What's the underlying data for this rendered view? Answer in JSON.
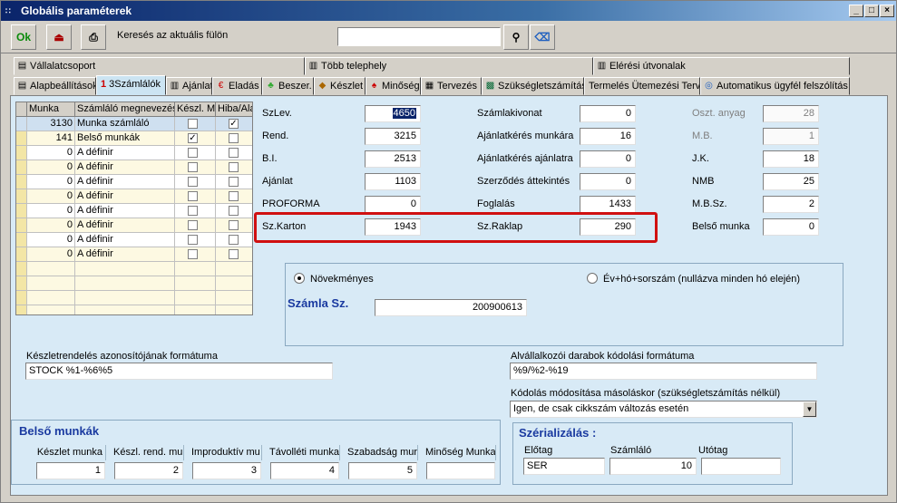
{
  "window": {
    "title": "Globális paraméterek"
  },
  "toolbar": {
    "ok_label": "Ok",
    "search_label": "Keresés az aktuális fülön",
    "search_value": ""
  },
  "tabs_top": [
    {
      "label": "Vállalatcsoport"
    },
    {
      "label": "Több telephely"
    },
    {
      "label": "Elérési útvonalak"
    }
  ],
  "tabs_bottom": [
    {
      "label": "Alapbeállítások"
    },
    {
      "number": "1",
      "label": "3Számlálók"
    },
    {
      "label": "Ajánlat"
    },
    {
      "label": "Eladás"
    },
    {
      "label": "Beszer."
    },
    {
      "label": "Készlet"
    },
    {
      "label": "Minőség"
    },
    {
      "label": "Tervezés"
    },
    {
      "label": "Szükségletszámítás"
    },
    {
      "label": "Termelés Ütemezési Terv"
    },
    {
      "label": "Automatikus ügyfél felszólítás"
    }
  ],
  "grid": {
    "headers": [
      "Munka",
      "Számláló megnevezése",
      "Készl. Mu",
      "Hiba/Ala"
    ],
    "rows": [
      {
        "munka": "3130",
        "name": "Munka számláló",
        "keszl": false,
        "hiba": true
      },
      {
        "munka": "141",
        "name": "Belső munkák",
        "keszl": true,
        "hiba": false
      },
      {
        "munka": "0",
        "name": "A définir",
        "keszl": false,
        "hiba": false
      },
      {
        "munka": "0",
        "name": "A définir",
        "keszl": false,
        "hiba": false
      },
      {
        "munka": "0",
        "name": "A définir",
        "keszl": false,
        "hiba": false
      },
      {
        "munka": "0",
        "name": "A définir",
        "keszl": false,
        "hiba": false
      },
      {
        "munka": "0",
        "name": "A définir",
        "keszl": false,
        "hiba": false
      },
      {
        "munka": "0",
        "name": "A définir",
        "keszl": false,
        "hiba": false
      },
      {
        "munka": "0",
        "name": "A définir",
        "keszl": false,
        "hiba": false
      },
      {
        "munka": "0",
        "name": "A définir",
        "keszl": false,
        "hiba": false
      }
    ]
  },
  "counters": {
    "col1": [
      {
        "label": "SzLev.",
        "value": "4650"
      },
      {
        "label": "Rend.",
        "value": "3215"
      },
      {
        "label": "B.I.",
        "value": "2513"
      },
      {
        "label": "Ajánlat",
        "value": "1103"
      },
      {
        "label": "PROFORMA",
        "value": "0"
      },
      {
        "label": "Sz.Karton",
        "value": "1943"
      }
    ],
    "col2": [
      {
        "label": "Számlakivonat",
        "value": "0"
      },
      {
        "label": "Ajánlatkérés munkára",
        "value": "16"
      },
      {
        "label": "Ajánlatkérés ajánlatra",
        "value": "0"
      },
      {
        "label": "Szerződés áttekintés",
        "value": "0"
      },
      {
        "label": "Foglalás",
        "value": "1433"
      },
      {
        "label": "Sz.Raklap",
        "value": "290"
      }
    ],
    "col3": [
      {
        "label": "Oszt. anyag",
        "value": "28",
        "disabled": true
      },
      {
        "label": "M.B.",
        "value": "1",
        "disabled": true
      },
      {
        "label": "J.K.",
        "value": "18",
        "disabled": false
      },
      {
        "label": "NMB",
        "value": "25",
        "disabled": false
      },
      {
        "label": "M.B.Sz.",
        "value": "2",
        "disabled": false
      },
      {
        "label": "Belső munka",
        "value": "0",
        "disabled": false
      }
    ]
  },
  "invoice": {
    "radio1": "Növekményes",
    "radio2": "Év+hó+sorszám (nullázva minden hó elején)",
    "title": "Számla Sz.",
    "value": "200900613"
  },
  "formats": {
    "stock_label": "Készletrendelés azonosítójának formátuma",
    "stock_value": "STOCK %1-%6%5",
    "sub_label": "Alvállalkozói darabok kódolási formátuma",
    "sub_value": "%9/%2-%19",
    "coding_label": "Kódolás módosítása másoláskor (szükségletszámítás nélkül)",
    "coding_value": "Igen, de csak cikkszám változás esetén"
  },
  "internal": {
    "title": "Belső munkák",
    "fields": [
      {
        "label": "Készlet munka",
        "value": "1"
      },
      {
        "label": "Készl. rend. mu",
        "value": "2"
      },
      {
        "label": "Improduktív mu",
        "value": "3"
      },
      {
        "label": "Távolléti munka",
        "value": "4"
      },
      {
        "label": "Szabadság mur",
        "value": "5"
      },
      {
        "label": "Minőség Munka",
        "value": ""
      }
    ]
  },
  "serial": {
    "title": "Szérializálás :",
    "prefix_label": "Előtag",
    "prefix_value": "SER",
    "counter_label": "Számláló",
    "counter_value": "10",
    "suffix_label": "Utótag",
    "suffix_value": ""
  }
}
